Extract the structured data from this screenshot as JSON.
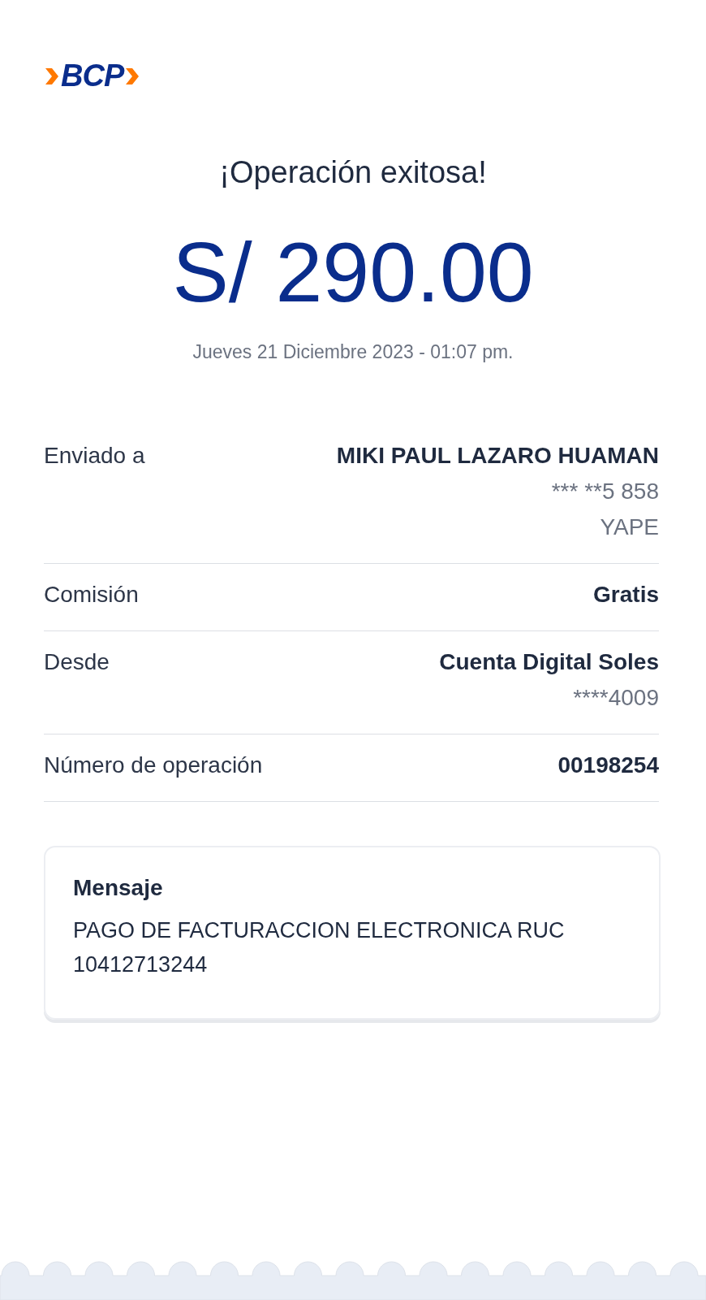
{
  "logo": {
    "text": "BCP"
  },
  "title": "¡Operación exitosa!",
  "amount": "S/ 290.00",
  "datetime": "Jueves 21 Diciembre 2023 - 01:07 pm.",
  "details": [
    {
      "label": "Enviado a",
      "lines": [
        {
          "text": "MIKI PAUL LAZARO HUAMAN",
          "kind": "primary"
        },
        {
          "text": "*** **5 858",
          "kind": "secondary"
        },
        {
          "text": "YAPE",
          "kind": "secondary"
        }
      ]
    },
    {
      "label": "Comisión",
      "lines": [
        {
          "text": "Gratis",
          "kind": "primary"
        }
      ]
    },
    {
      "label": "Desde",
      "lines": [
        {
          "text": "Cuenta Digital Soles",
          "kind": "primary"
        },
        {
          "text": "****4009",
          "kind": "secondary"
        }
      ]
    },
    {
      "label": "Número de operación",
      "lines": [
        {
          "text": "00198254",
          "kind": "primary"
        }
      ]
    }
  ],
  "message": {
    "title": "Mensaje",
    "text": "PAGO DE FACTURACCION ELECTRONICA RUC 10412713244"
  }
}
